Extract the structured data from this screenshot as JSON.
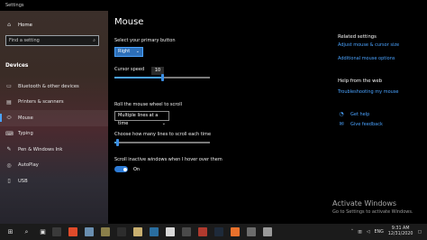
{
  "window": {
    "title": "Settings"
  },
  "sidebar": {
    "home_label": "Home",
    "search_placeholder": "Find a setting",
    "section_label": "Devices",
    "items": [
      {
        "label": "Bluetooth & other devices",
        "icon": "bluetooth-devices-icon"
      },
      {
        "label": "Printers & scanners",
        "icon": "printer-icon"
      },
      {
        "label": "Mouse",
        "icon": "mouse-icon",
        "active": true
      },
      {
        "label": "Typing",
        "icon": "keyboard-icon"
      },
      {
        "label": "Pen & Windows Ink",
        "icon": "pen-icon"
      },
      {
        "label": "AutoPlay",
        "icon": "autoplay-icon"
      },
      {
        "label": "USB",
        "icon": "usb-icon"
      }
    ]
  },
  "main": {
    "title": "Mouse",
    "primary_button_label": "Select your primary button",
    "primary_button_value": "Right",
    "cursor_speed_label": "Cursor speed",
    "cursor_speed_value": "10",
    "cursor_speed_fraction": 0.5,
    "wheel_label": "Roll the mouse wheel to scroll",
    "wheel_value": "Multiple lines at a time",
    "lines_label": "Choose how many lines to scroll each time",
    "lines_fraction": 0.03,
    "inactive_label": "Scroll inactive windows when I hover over them",
    "inactive_state": "On"
  },
  "related": {
    "heading": "Related settings",
    "links": [
      "Adjust mouse & cursor size",
      "Additional mouse options"
    ]
  },
  "help": {
    "heading": "Help from the web",
    "link": "Troubleshooting my mouse",
    "get_help": "Get help",
    "give_feedback": "Give feedback"
  },
  "watermark": {
    "line1": "Activate Windows",
    "line2": "Go to Settings to activate Windows."
  },
  "taskbar": {
    "language": "ENG",
    "time": "9:31 AM",
    "date": "12/31/2020"
  },
  "colors": {
    "accent": "#4aa3ff",
    "toggle_on": "#2d7bd6",
    "primary_button": "#2d6fb8"
  }
}
